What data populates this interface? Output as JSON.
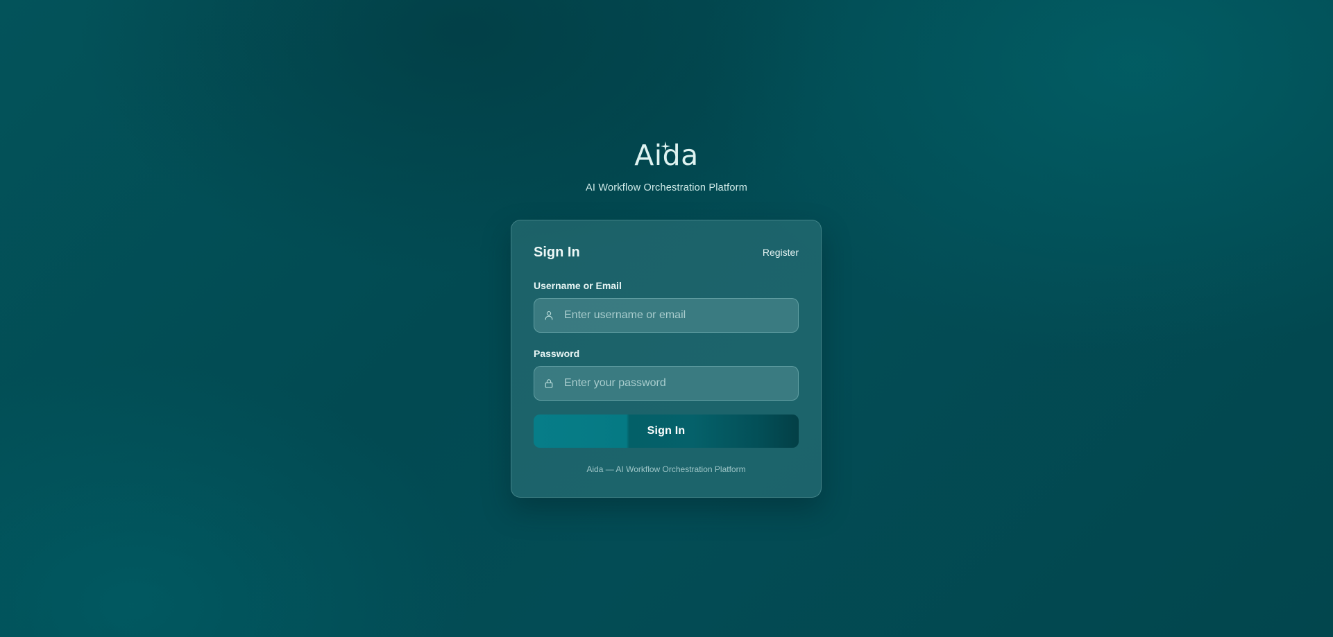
{
  "brand": {
    "logo_text": "Aida",
    "tagline": "AI Workflow Orchestration Platform"
  },
  "login_card": {
    "title": "Sign In",
    "register_label": "Register",
    "username": {
      "label": "Username or Email",
      "placeholder": "Enter username or email",
      "value": "",
      "icon": "user-icon"
    },
    "password": {
      "label": "Password",
      "placeholder": "Enter your password",
      "value": "",
      "icon": "lock-icon"
    },
    "submit_label": "Sign In",
    "footer": "Aida — AI Workflow Orchestration Platform"
  },
  "colors": {
    "background": "#024a52",
    "card": "#3d7f84",
    "button_start": "#077d88",
    "button_end": "#033f46",
    "text": "#e6f4f3"
  }
}
